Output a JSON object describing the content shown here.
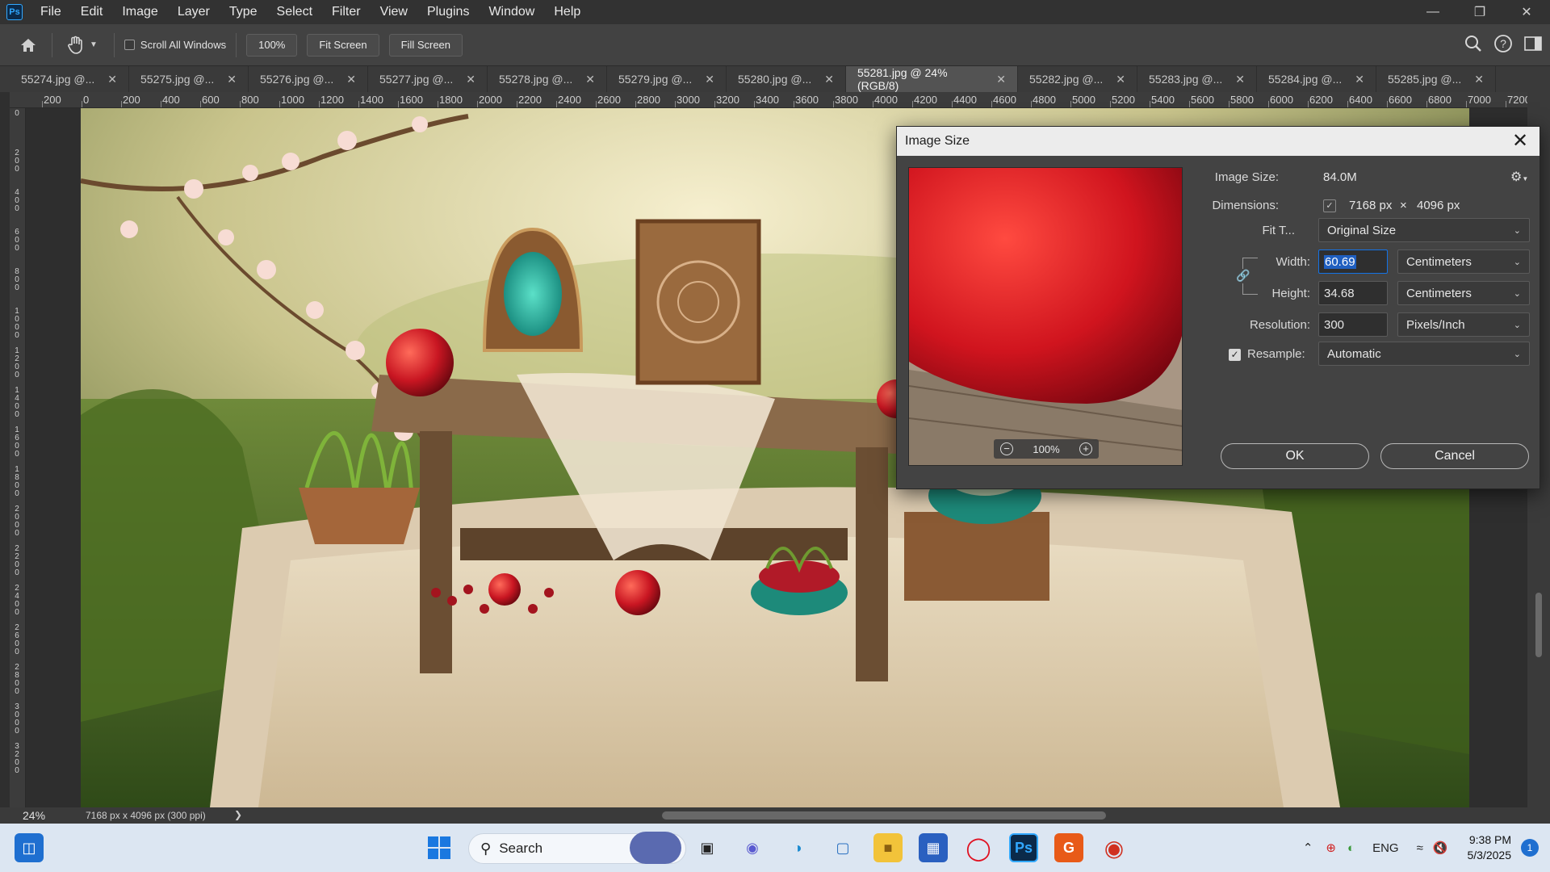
{
  "menu": {
    "app_icon": "Ps",
    "items": [
      "File",
      "Edit",
      "Image",
      "Layer",
      "Type",
      "Select",
      "Filter",
      "View",
      "Plugins",
      "Window",
      "Help"
    ]
  },
  "options": {
    "scroll_all_label": "Scroll All Windows",
    "zoom_100": "100%",
    "fit_screen": "Fit Screen",
    "fill_screen": "Fill Screen"
  },
  "tabs": [
    {
      "label": "55274.jpg @...",
      "active": false
    },
    {
      "label": "55275.jpg @...",
      "active": false
    },
    {
      "label": "55276.jpg @...",
      "active": false
    },
    {
      "label": "55277.jpg @...",
      "active": false
    },
    {
      "label": "55278.jpg @...",
      "active": false
    },
    {
      "label": "55279.jpg @...",
      "active": false
    },
    {
      "label": "55280.jpg @...",
      "active": false
    },
    {
      "label": "55281.jpg @ 24% (RGB/8)",
      "active": true
    },
    {
      "label": "55282.jpg @...",
      "active": false
    },
    {
      "label": "55283.jpg @...",
      "active": false
    },
    {
      "label": "55284.jpg @...",
      "active": false
    },
    {
      "label": "55285.jpg @...",
      "active": false
    }
  ],
  "ruler": {
    "labels": [
      "200",
      "0",
      "200",
      "400",
      "600",
      "800",
      "1000",
      "1200",
      "1400",
      "1600",
      "1800",
      "2000",
      "2200",
      "2400",
      "2600",
      "2800",
      "3000",
      "3200",
      "3400",
      "3600",
      "3800",
      "4000",
      "4200",
      "4400",
      "4600",
      "4800",
      "5000",
      "5200",
      "5400",
      "5600",
      "5800",
      "6000",
      "6200",
      "6400",
      "6600",
      "6800",
      "7000",
      "7200",
      "7"
    ],
    "v_labels": [
      "0",
      "2 0 0",
      "4 0 0",
      "6 0 0",
      "8 0 0",
      "1 0 0 0",
      "1 2 0 0",
      "1 4 0 0",
      "1 6 0 0",
      "1 8 0 0",
      "2 0 0 0",
      "2 2 0 0",
      "2 4 0 0",
      "2 6 0 0",
      "2 8 0 0",
      "3 0 0 0",
      "3 2 0 0"
    ]
  },
  "status": {
    "zoom": "24%",
    "doc_info": "7168 px x 4096 px (300 ppi)"
  },
  "dialog": {
    "title": "Image Size",
    "image_size_label": "Image Size:",
    "image_size_value": "84.0M",
    "dimensions_label": "Dimensions:",
    "dim_width": "7168 px",
    "dim_x": "×",
    "dim_height": "4096 px",
    "fit_label": "Fit T...",
    "fit_value": "Original Size",
    "width_label": "Width:",
    "width_value": "60.69",
    "width_unit": "Centimeters",
    "height_label": "Height:",
    "height_value": "34.68",
    "height_unit": "Centimeters",
    "resolution_label": "Resolution:",
    "resolution_value": "300",
    "resolution_unit": "Pixels/Inch",
    "resample_label": "Resample:",
    "resample_checked": true,
    "resample_value": "Automatic",
    "preview_zoom": "100%",
    "ok": "OK",
    "cancel": "Cancel"
  },
  "taskbar": {
    "search_label": "Search",
    "language": "ENG",
    "time": "9:38 PM",
    "date": "5/3/2025",
    "notifications": "1"
  },
  "colors": {
    "accent": "#1473e6",
    "taskbar_bg": "#dce6f2",
    "ui_dark": "#323232"
  }
}
